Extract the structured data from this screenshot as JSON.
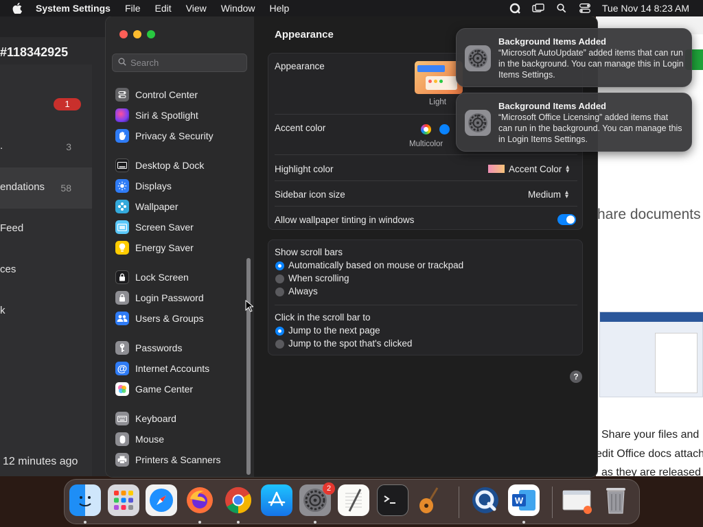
{
  "menubar": {
    "app_name": "System Settings",
    "items": [
      "File",
      "Edit",
      "View",
      "Window",
      "Help"
    ],
    "clock": "Tue Nov 14  8:23 AM"
  },
  "background_left": {
    "ticket": "#118342925",
    "rows": [
      {
        "label": "",
        "badge": "1"
      },
      {
        "label": "",
        "count": "3"
      },
      {
        "label": "endations",
        "count": "58"
      },
      {
        "label": "Feed"
      },
      {
        "label": "ces"
      },
      {
        "label": "k"
      }
    ],
    "ago": "12 minutes ago"
  },
  "background_right": {
    "headline": "hare documents",
    "para1": "Share your files and",
    "para2": "edit Office docs attach",
    "para3": "as they are released"
  },
  "settings": {
    "search_placeholder": "Search",
    "sidebar": [
      {
        "label": "Control Center",
        "icon": "control-center-icon",
        "color": "#636366"
      },
      {
        "label": "Siri & Spotlight",
        "icon": "siri-icon",
        "color": "#b23fd1"
      },
      {
        "label": "Privacy & Security",
        "icon": "hand-icon",
        "color": "#2f7cf6"
      },
      {
        "label": "Desktop & Dock",
        "icon": "dock-icon",
        "color": "#1c1c1e"
      },
      {
        "label": "Displays",
        "icon": "sun-icon",
        "color": "#2f7cf6"
      },
      {
        "label": "Wallpaper",
        "icon": "wallpaper-icon",
        "color": "#34aadc"
      },
      {
        "label": "Screen Saver",
        "icon": "screen-saver-icon",
        "color": "#5ac8fa"
      },
      {
        "label": "Energy Saver",
        "icon": "bulb-icon",
        "color": "#ffcc00"
      },
      {
        "label": "Lock Screen",
        "icon": "lock-screen-icon",
        "color": "#1c1c1e"
      },
      {
        "label": "Login Password",
        "icon": "lock-icon",
        "color": "#8e8e93"
      },
      {
        "label": "Users & Groups",
        "icon": "users-icon",
        "color": "#2f7cf6"
      },
      {
        "label": "Passwords",
        "icon": "key-icon",
        "color": "#8e8e93"
      },
      {
        "label": "Internet Accounts",
        "icon": "at-icon",
        "color": "#2f7cf6"
      },
      {
        "label": "Game Center",
        "icon": "game-center-icon",
        "color": "#ffffff"
      },
      {
        "label": "Keyboard",
        "icon": "keyboard-icon",
        "color": "#8e8e93"
      },
      {
        "label": "Mouse",
        "icon": "mouse-icon",
        "color": "#8e8e93"
      },
      {
        "label": "Printers & Scanners",
        "icon": "printer-icon",
        "color": "#8e8e93"
      }
    ],
    "title": "Appearance",
    "appearance_label": "Appearance",
    "appearance_option": "Light",
    "accent_label": "Accent color",
    "accent_value": "Multicolor",
    "highlight_label": "Highlight color",
    "highlight_value": "Accent Color",
    "sidebar_icon_label": "Sidebar icon size",
    "sidebar_icon_value": "Medium",
    "tinting_label": "Allow wallpaper tinting in windows",
    "tinting_on": true,
    "scroll_title": "Show scroll bars",
    "scroll_options": [
      "Automatically based on mouse or trackpad",
      "When scrolling",
      "Always"
    ],
    "click_title": "Click in the scroll bar to",
    "click_options": [
      "Jump to the next page",
      "Jump to the spot that's clicked"
    ],
    "help": "?"
  },
  "notifications": [
    {
      "title": "Background Items Added",
      "body": "“Microsoft AutoUpdate” added items that can run in the background. You can manage this in Login Items Settings."
    },
    {
      "title": "Background Items Added",
      "body": "“Microsoft Office Licensing” added items that can run in the background. You can manage this in Login Items Settings."
    }
  ],
  "dock": {
    "apps": [
      "Finder",
      "Launchpad",
      "Safari",
      "Firefox",
      "Chrome",
      "App Store",
      "System Settings",
      "TextEdit",
      "Terminal",
      "GarageBand",
      "QuickTime",
      "Word",
      "Downloads",
      "Trash"
    ],
    "settings_badge": "2"
  }
}
